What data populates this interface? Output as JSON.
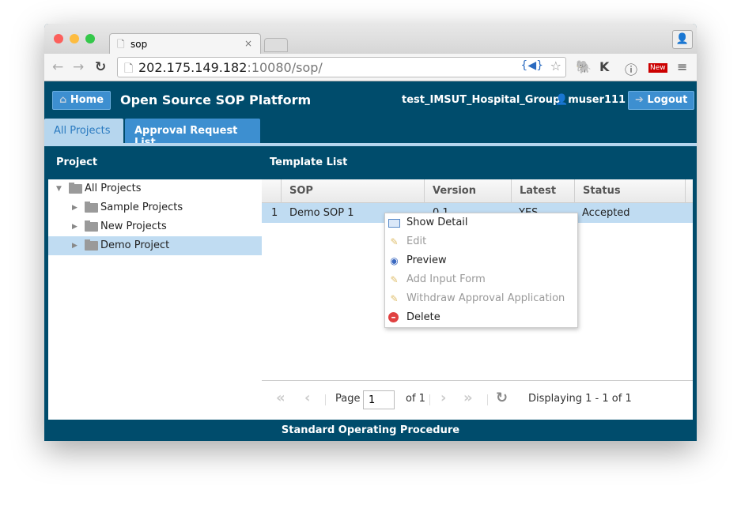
{
  "browser": {
    "tab_title": "sop",
    "url_host": "202.175.149.182",
    "url_rest": ":10080/sop/"
  },
  "header": {
    "home": "Home",
    "title": "Open Source SOP Platform",
    "group": "test_IMSUT_Hospital_Group",
    "user": "muser111",
    "logout": "Logout"
  },
  "tabs": [
    {
      "label": "All Projects",
      "active": true
    },
    {
      "label": "Approval Request List",
      "active": false
    }
  ],
  "project_panel": {
    "title": "Project",
    "items": [
      {
        "label": "All Projects"
      },
      {
        "label": "Sample Projects"
      },
      {
        "label": "New Projects"
      },
      {
        "label": "Demo Project",
        "selected": true
      }
    ]
  },
  "template_panel": {
    "title": "Template List",
    "columns": [
      "SOP",
      "Version",
      "Latest",
      "Status"
    ],
    "rows": [
      {
        "num": "1",
        "sop": "Demo SOP 1",
        "version": "0.1",
        "latest": "YES",
        "status": "Accepted"
      }
    ]
  },
  "context_menu": [
    {
      "label": "Show Detail",
      "icon": "table-icon",
      "enabled": true
    },
    {
      "label": "Edit",
      "icon": "pencil-icon",
      "enabled": false
    },
    {
      "label": "Preview",
      "icon": "eye-icon",
      "enabled": true
    },
    {
      "label": "Add Input Form",
      "icon": "pencil-icon",
      "enabled": false
    },
    {
      "label": "Withdraw Approval Application",
      "icon": "pencil-icon",
      "enabled": false
    },
    {
      "label": "Delete",
      "icon": "delete-icon",
      "enabled": true
    }
  ],
  "pager": {
    "page_label": "Page",
    "page": "1",
    "of": "of 1",
    "display": "Displaying 1 - 1 of 1"
  },
  "footer": "Standard Operating Procedure",
  "colors": {
    "header_bg": "#004c6c",
    "accent": "#3d8fd0",
    "selection": "#c0dcf2"
  }
}
